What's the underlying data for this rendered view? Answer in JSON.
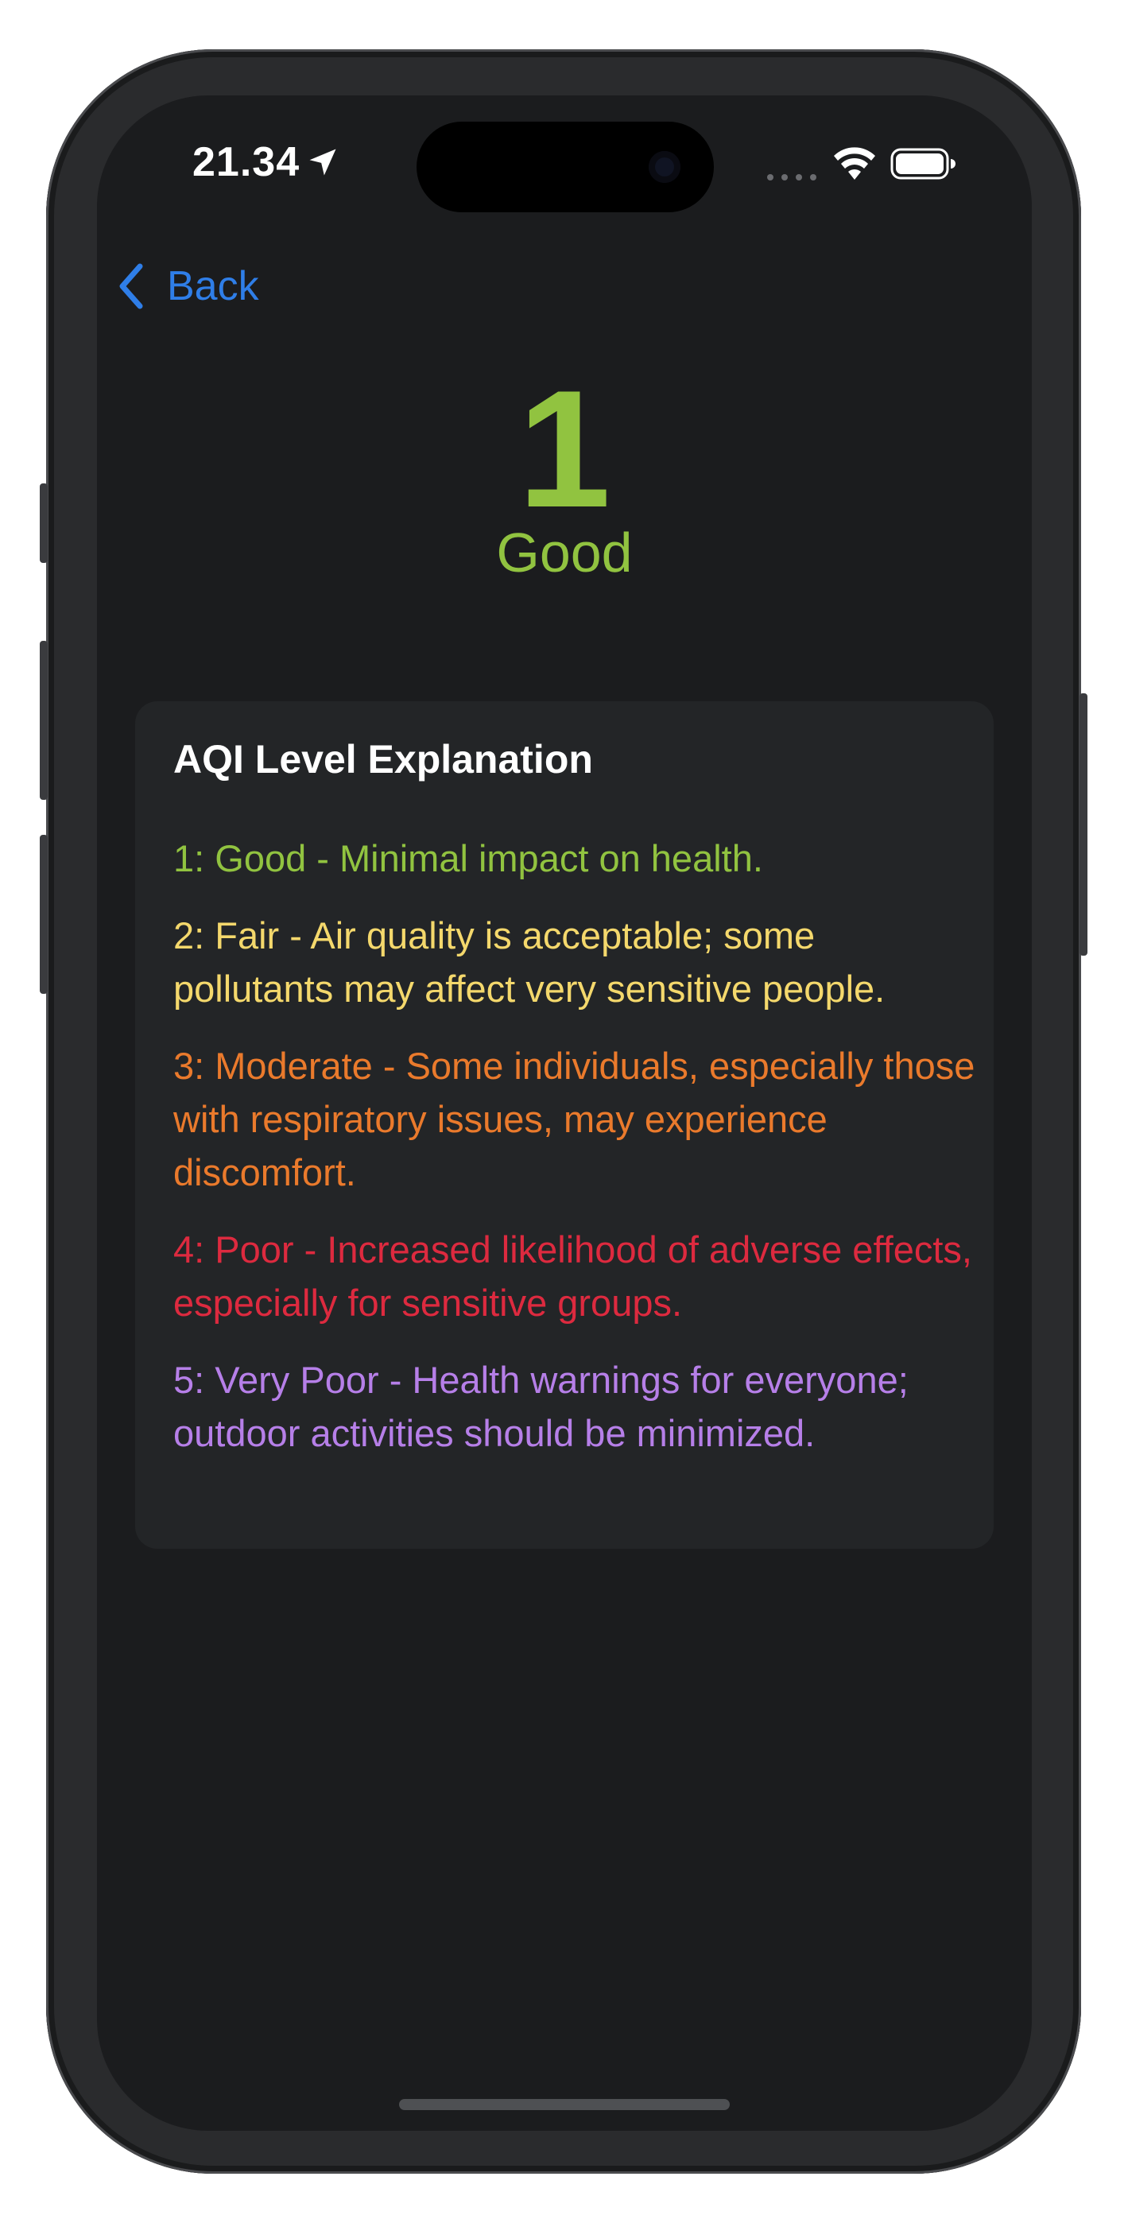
{
  "status_bar": {
    "time": "21.34"
  },
  "nav": {
    "back_label": "Back"
  },
  "aqi": {
    "value": "1",
    "label": "Good",
    "color": "#91c340"
  },
  "explanation": {
    "title": "AQI Level Explanation",
    "levels": [
      {
        "text": "1: Good - Minimal impact on health.",
        "color": "#91c340"
      },
      {
        "text": "2: Fair - Air quality is acceptable; some pollutants may affect very sensitive people.",
        "color": "#f4d86c"
      },
      {
        "text": "3: Moderate - Some individuals, especially those with respiratory issues, may experience discomfort.",
        "color": "#ea7a2c"
      },
      {
        "text": "4: Poor - Increased likelihood of adverse effects, especially for sensitive groups.",
        "color": "#dd2a3f"
      },
      {
        "text": "5: Very Poor - Health warnings for everyone; outdoor activities should be minimized.",
        "color": "#b67fe8"
      }
    ]
  },
  "colors": {
    "accent_link": "#2f7ee8",
    "screen_background": "#1b1c1e",
    "card_background": "#232527"
  },
  "icons": [
    "location-arrow-icon",
    "wifi-icon",
    "battery-icon",
    "chevron-left-icon"
  ]
}
